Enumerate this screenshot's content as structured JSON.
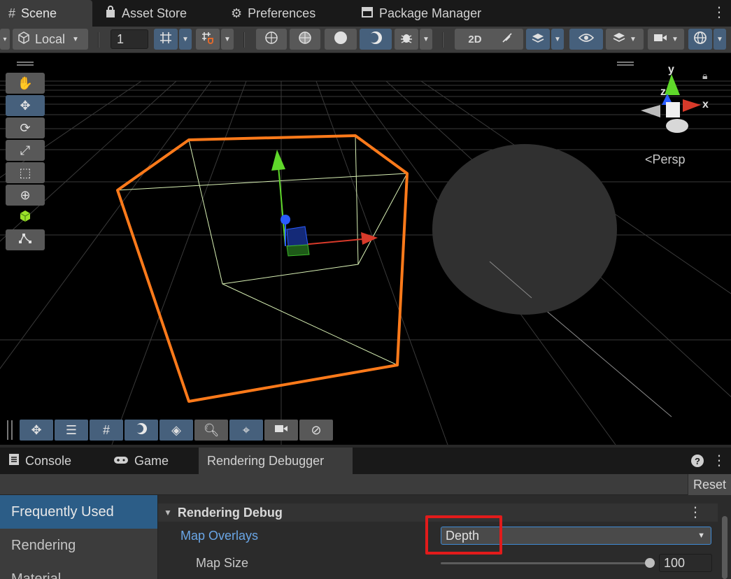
{
  "window_tabs": [
    {
      "label": "Scene",
      "icon": "hash-icon",
      "active": true
    },
    {
      "label": "Asset Store",
      "icon": "bag-icon",
      "active": false
    },
    {
      "label": "Preferences",
      "icon": "gear-icon",
      "active": false
    },
    {
      "label": "Package Manager",
      "icon": "package-icon",
      "active": false
    }
  ],
  "toolbar": {
    "pivot_space": "Local",
    "grid_snap_value": "1"
  },
  "viewport": {
    "projection_label": "Persp",
    "gizmo_axes": {
      "x": "x",
      "y": "y",
      "z": "z"
    },
    "colors": {
      "selection_outline": "#ff7a1a",
      "x_axis": "#d83a2a",
      "y_axis": "#5fd82a",
      "z_axis": "#2a5cff"
    }
  },
  "panel_tabs": [
    {
      "label": "Console",
      "icon": "console-icon",
      "active": false
    },
    {
      "label": "Game",
      "icon": "gamepad-icon",
      "active": false
    },
    {
      "label": "Rendering Debugger",
      "icon": "",
      "active": true
    }
  ],
  "panel": {
    "reset_label": "Reset",
    "sidebar": [
      "Frequently Used",
      "Rendering",
      "Material"
    ],
    "section_title": "Rendering Debug",
    "map_overlays_label": "Map Overlays",
    "map_overlays_value": "Depth",
    "map_size_label": "Map Size",
    "map_size_value": "100",
    "map_size_fraction": 1.0
  }
}
